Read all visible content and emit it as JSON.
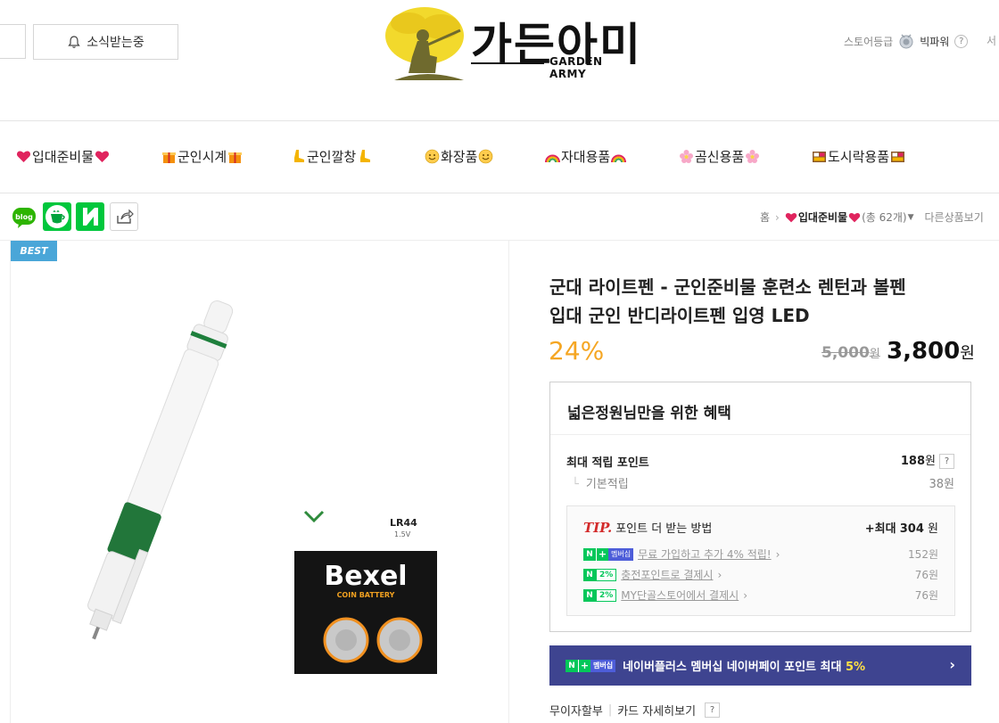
{
  "header": {
    "notify_label": "소식받는중",
    "logo_text": "가든아미",
    "logo_sub": "GARDEN ARMY",
    "store_grade_label": "스토어등급",
    "store_grade_value": "빅파워",
    "help_mark": "?",
    "cut_text": "서"
  },
  "categories": [
    {
      "label": "입대준비물"
    },
    {
      "label": "군인시계"
    },
    {
      "label": "군인깔창"
    },
    {
      "label": "화장품"
    },
    {
      "label": "자대용품"
    },
    {
      "label": "곰신용품"
    },
    {
      "label": "도시락용품"
    }
  ],
  "share": {
    "blog_label": "blog"
  },
  "breadcrumb": {
    "home": "홈",
    "current": "입대준비물",
    "count": "(총 62개)",
    "other": "다른상품보기"
  },
  "product": {
    "best_label": "BEST",
    "title_line1": "군대 라이트펜 - 군인준비물 훈련소 렌턴과 볼펜",
    "title_line2": "입대 군인 반디라이트펜 입영 LED",
    "discount": "24%",
    "original_price": "5,000",
    "original_unit": "원",
    "price": "3,800",
    "price_unit": "원",
    "battery_brand": "Bexel",
    "battery_sub": "COIN BATTERY",
    "battery_model": "LR44",
    "battery_volt": "1.5V"
  },
  "benefit": {
    "title": "넓은정원님만을 위한 혜택",
    "max_points_label": "최대 적립 포인트",
    "max_points_value": "188",
    "max_points_unit": "원",
    "basic_label": "기본적립",
    "basic_value": "38원",
    "tip_label": "TIP.",
    "tip_text": "포인트 더 받는 방법",
    "tip_max_prefix": "+최대",
    "tip_max_value": "304",
    "tip_max_unit": "원",
    "tips": [
      {
        "badge_type": "membership",
        "badge_text": "멤버십",
        "text": "무료 가입하고 추가 4% 적립!",
        "value": "152원"
      },
      {
        "badge_type": "pct",
        "badge_text": "2%",
        "text": "충전포인트로 결제시",
        "value": "76원"
      },
      {
        "badge_type": "pct",
        "badge_text": "2%",
        "text": "MY단골스토어에서 결제시",
        "value": "76원"
      }
    ]
  },
  "naver_banner": {
    "badge_text": "멤버십",
    "text": "네이버플러스 멤버십 네이버페이 포인트 최대",
    "highlight": "5%",
    "arrow": "›"
  },
  "installment": {
    "label": "무이자할부",
    "card_label": "카드 자세히보기",
    "help": "?"
  },
  "colors": {
    "discount": "#f5a623",
    "naver_green": "#03c75a",
    "banner_bg": "#3e4490",
    "best_bg": "#4aa6d8"
  }
}
